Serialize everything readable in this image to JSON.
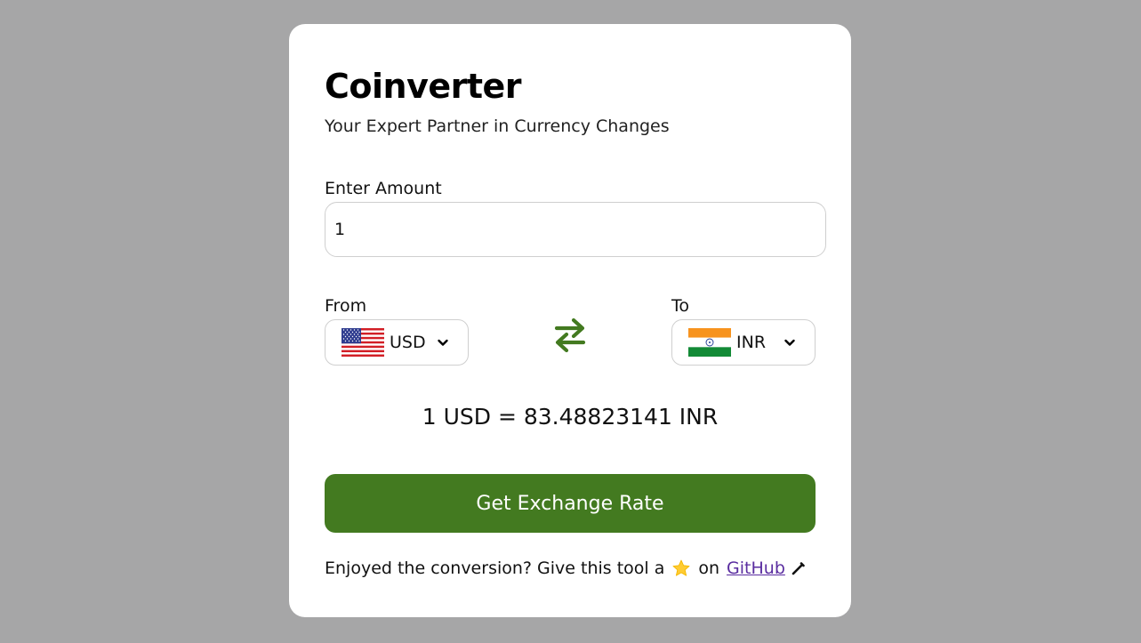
{
  "app": {
    "title": "Coinverter",
    "subtitle": "Your Expert Partner in Currency Changes"
  },
  "amount": {
    "label": "Enter Amount",
    "value": "1"
  },
  "from": {
    "label": "From",
    "currency": "USD",
    "flag_icon": "us-flag-icon"
  },
  "to": {
    "label": "To",
    "currency": "INR",
    "flag_icon": "india-flag-icon"
  },
  "swap_icon": "swap-arrows-icon",
  "result_text": "1 USD = 83.48823141 INR",
  "button_label": "Get Exchange Rate",
  "footer": {
    "text_before": "Enjoyed the conversion? Give this tool a",
    "text_on": "on",
    "link_text": "GitHub",
    "star_icon": "star-icon",
    "pencil_icon": "pencil-icon"
  },
  "colors": {
    "background": "#a6a6a7",
    "card": "#ffffff",
    "accent": "#437a20",
    "link": "#5a2da0"
  }
}
